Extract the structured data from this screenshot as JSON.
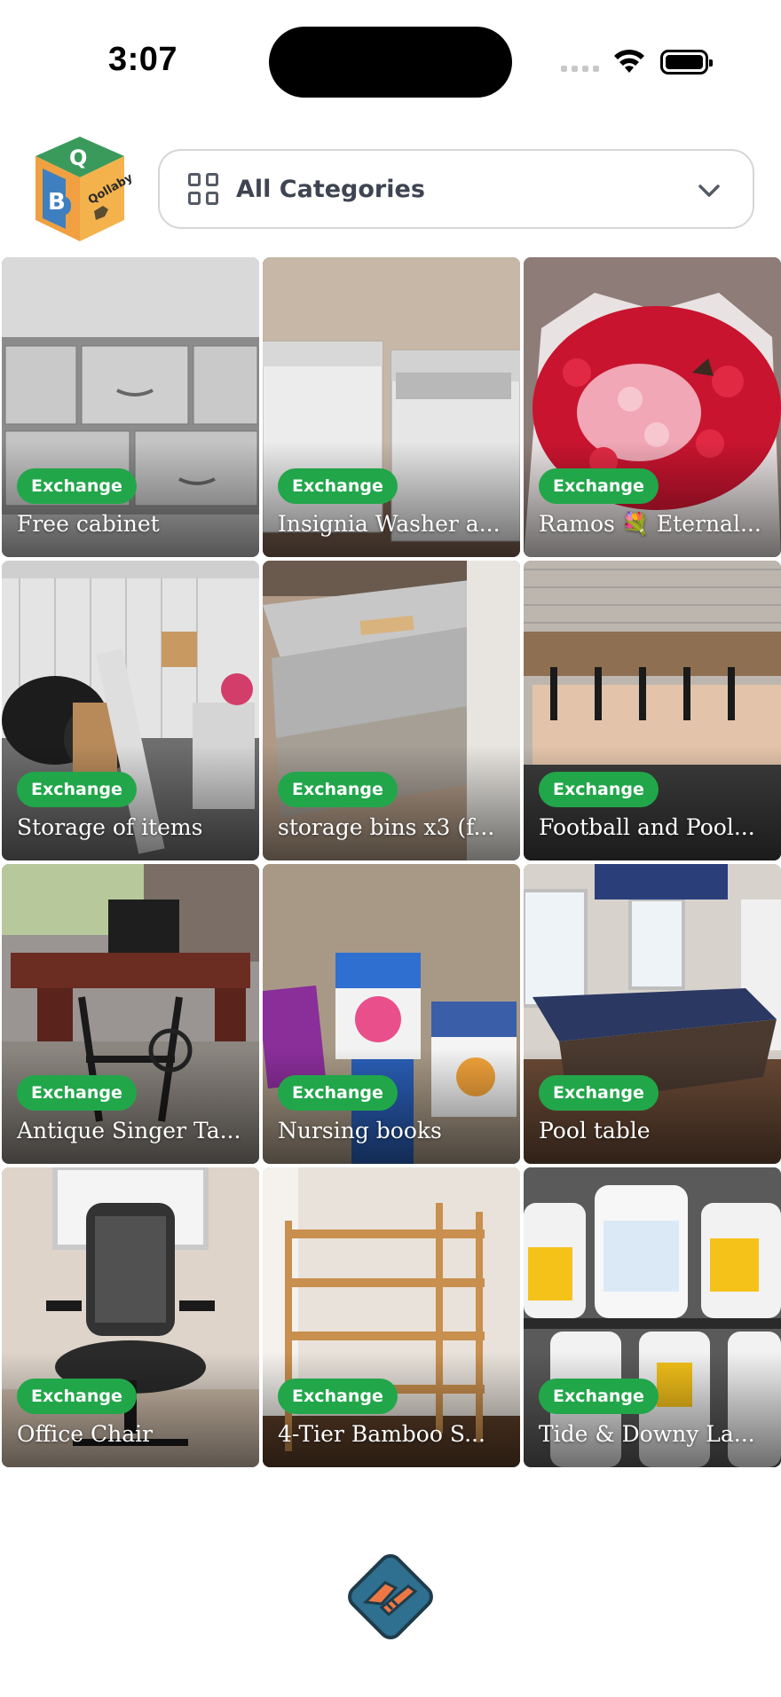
{
  "status_bar": {
    "time": "3:07"
  },
  "header": {
    "logo_text": "Qollaby",
    "category_label": "All Categories"
  },
  "listings": [
    {
      "badge": "Exchange",
      "title": "Free cabinet"
    },
    {
      "badge": "Exchange",
      "title": "Insignia Washer a..."
    },
    {
      "badge": "Exchange",
      "title": "Ramos 💐 Eternal..."
    },
    {
      "badge": "Exchange",
      "title": "Storage of items"
    },
    {
      "badge": "Exchange",
      "title": "storage bins x3 (f..."
    },
    {
      "badge": "Exchange",
      "title": "Football and Pool..."
    },
    {
      "badge": "Exchange",
      "title": "Antique Singer Ta..."
    },
    {
      "badge": "Exchange",
      "title": "Nursing books"
    },
    {
      "badge": "Exchange",
      "title": "Pool table"
    },
    {
      "badge": "Exchange",
      "title": "Office Chair"
    },
    {
      "badge": "Exchange",
      "title": "4-Tier Bamboo S..."
    },
    {
      "badge": "Exchange",
      "title": "Tide & Downy La..."
    }
  ],
  "colors": {
    "badge": "#22a64a",
    "logo_green": "#3a9a5b",
    "logo_orange": "#f0a040",
    "logo_blue": "#3f7fbf",
    "handshake_blue": "#2f6f8f",
    "handshake_orange": "#ee7744"
  }
}
